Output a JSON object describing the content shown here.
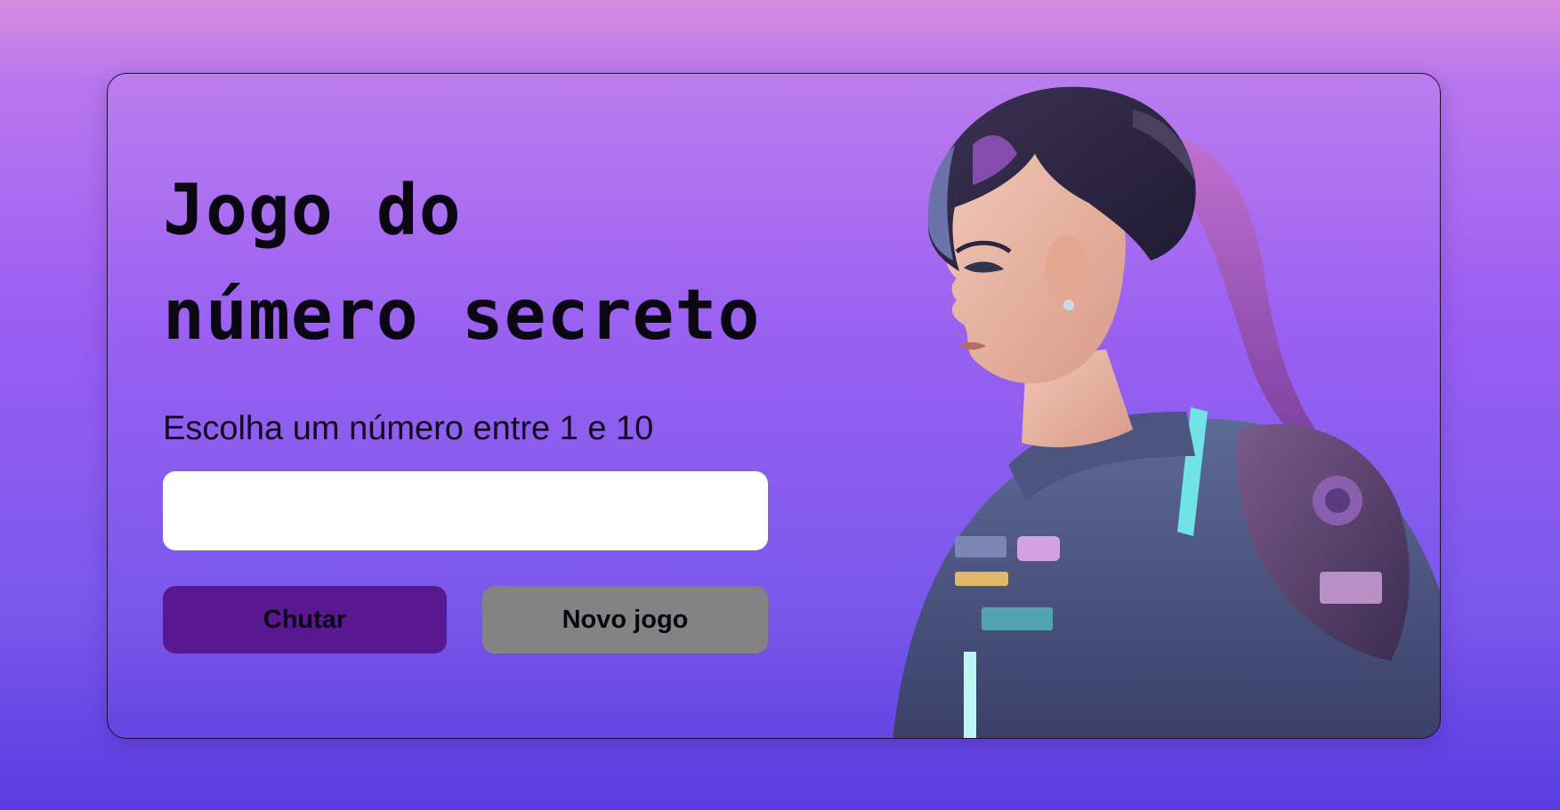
{
  "game": {
    "title_line1": "Jogo do",
    "title_line2": "número secreto",
    "prompt": "Escolha um número entre 1 e 10",
    "input_value": "",
    "guess_button": "Chutar",
    "new_game_button": "Novo jogo"
  },
  "colors": {
    "guess_button": "#5a1890",
    "new_game_button": "#838383",
    "input_background": "#ffffff",
    "text": "#0a0612"
  },
  "illustration": {
    "icon": "astronaut-girl-illustration"
  }
}
